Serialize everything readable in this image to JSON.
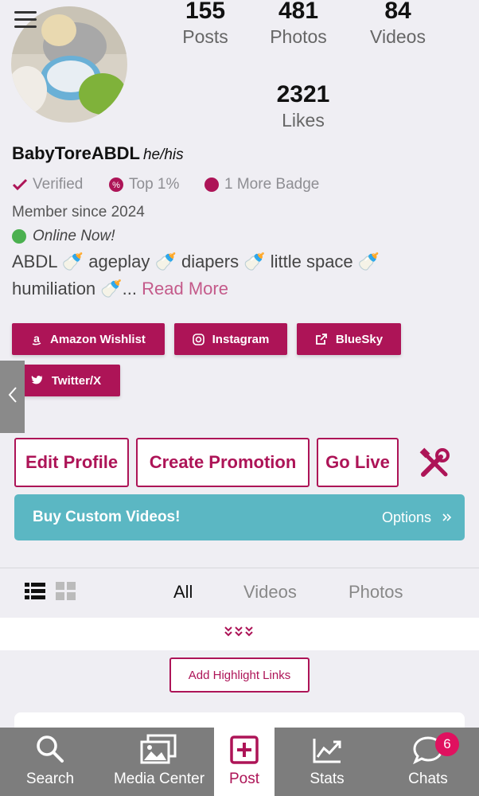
{
  "profile": {
    "username": "BabyToreABDL",
    "pronouns": "he/his",
    "avatar_icon": "profile-photo"
  },
  "stats": {
    "posts": {
      "value": "155",
      "label": "Posts"
    },
    "photos": {
      "value": "481",
      "label": "Photos"
    },
    "videos": {
      "value": "84",
      "label": "Videos"
    },
    "likes": {
      "value": "2321",
      "label": "Likes"
    }
  },
  "badges": {
    "verified": "Verified",
    "top": "Top 1%",
    "more": "1 More Badge"
  },
  "member_since": "Member since 2024",
  "online_status": "Online Now!",
  "bio": {
    "line1": "ABDL 🍼 ageplay 🍼 diapers 🍼 little space 🍼",
    "line2": "humiliation 🍼...",
    "read_more": "Read More"
  },
  "social_links": {
    "amazon": "Amazon Wishlist",
    "instagram": "Instagram",
    "bluesky": "BlueSky",
    "twitter": "Twitter/X"
  },
  "actions": {
    "edit_profile": "Edit Profile",
    "create_promotion": "Create Promotion",
    "go_live": "Go Live"
  },
  "custom_videos": {
    "title": "Buy Custom Videos!",
    "options": "Options"
  },
  "tabs": {
    "all": "All",
    "videos": "Videos",
    "photos": "Photos"
  },
  "highlight_button": "Add Highlight Links",
  "bottom_nav": {
    "search": "Search",
    "media_center": "Media Center",
    "post": "Post",
    "stats": "Stats",
    "chats": "Chats",
    "chats_badge": "6"
  },
  "colors": {
    "brand": "#ad1457",
    "banner": "#5bb7c3",
    "nav_bg": "#7d7d7d",
    "online": "#4bb04f"
  }
}
